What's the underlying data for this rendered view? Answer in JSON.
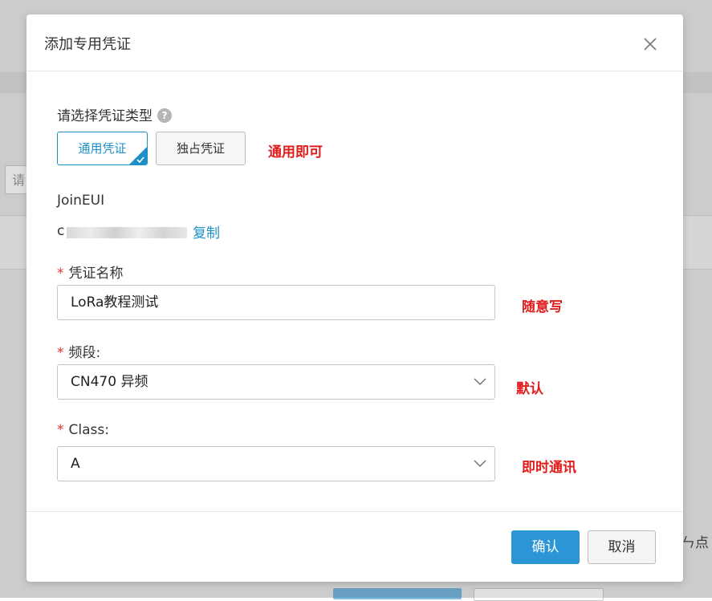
{
  "background": {
    "search_placeholder": "请",
    "edge_text": "点"
  },
  "modal": {
    "title": "添加专用凭证",
    "credential_type": {
      "label": "请选择凭证类型",
      "help": "?",
      "options": [
        "通用凭证",
        "独占凭证"
      ],
      "selected": "通用凭证",
      "annotation": "通用即可"
    },
    "join_eui": {
      "label": "JoinEUI",
      "value_prefix": "c",
      "copy_label": "复制"
    },
    "credential_name": {
      "label": "凭证名称",
      "value": "LoRa教程测试",
      "annotation": "随意写"
    },
    "frequency_band": {
      "label": "频段:",
      "value": "CN470 异频",
      "annotation": "默认"
    },
    "class": {
      "label": "Class:",
      "value": "A",
      "annotation": "即时通讯"
    },
    "footer": {
      "confirm_label": "确认",
      "cancel_label": "取消"
    }
  },
  "colors": {
    "accent": "#1f8fc7",
    "primary_button": "#2b95d6",
    "annotation": "#e11c1c",
    "required": "#e13131"
  },
  "icons": {
    "close": "close-icon",
    "help": "question-circle-icon",
    "dropdown": "chevron-down-icon",
    "selected": "check-icon"
  }
}
